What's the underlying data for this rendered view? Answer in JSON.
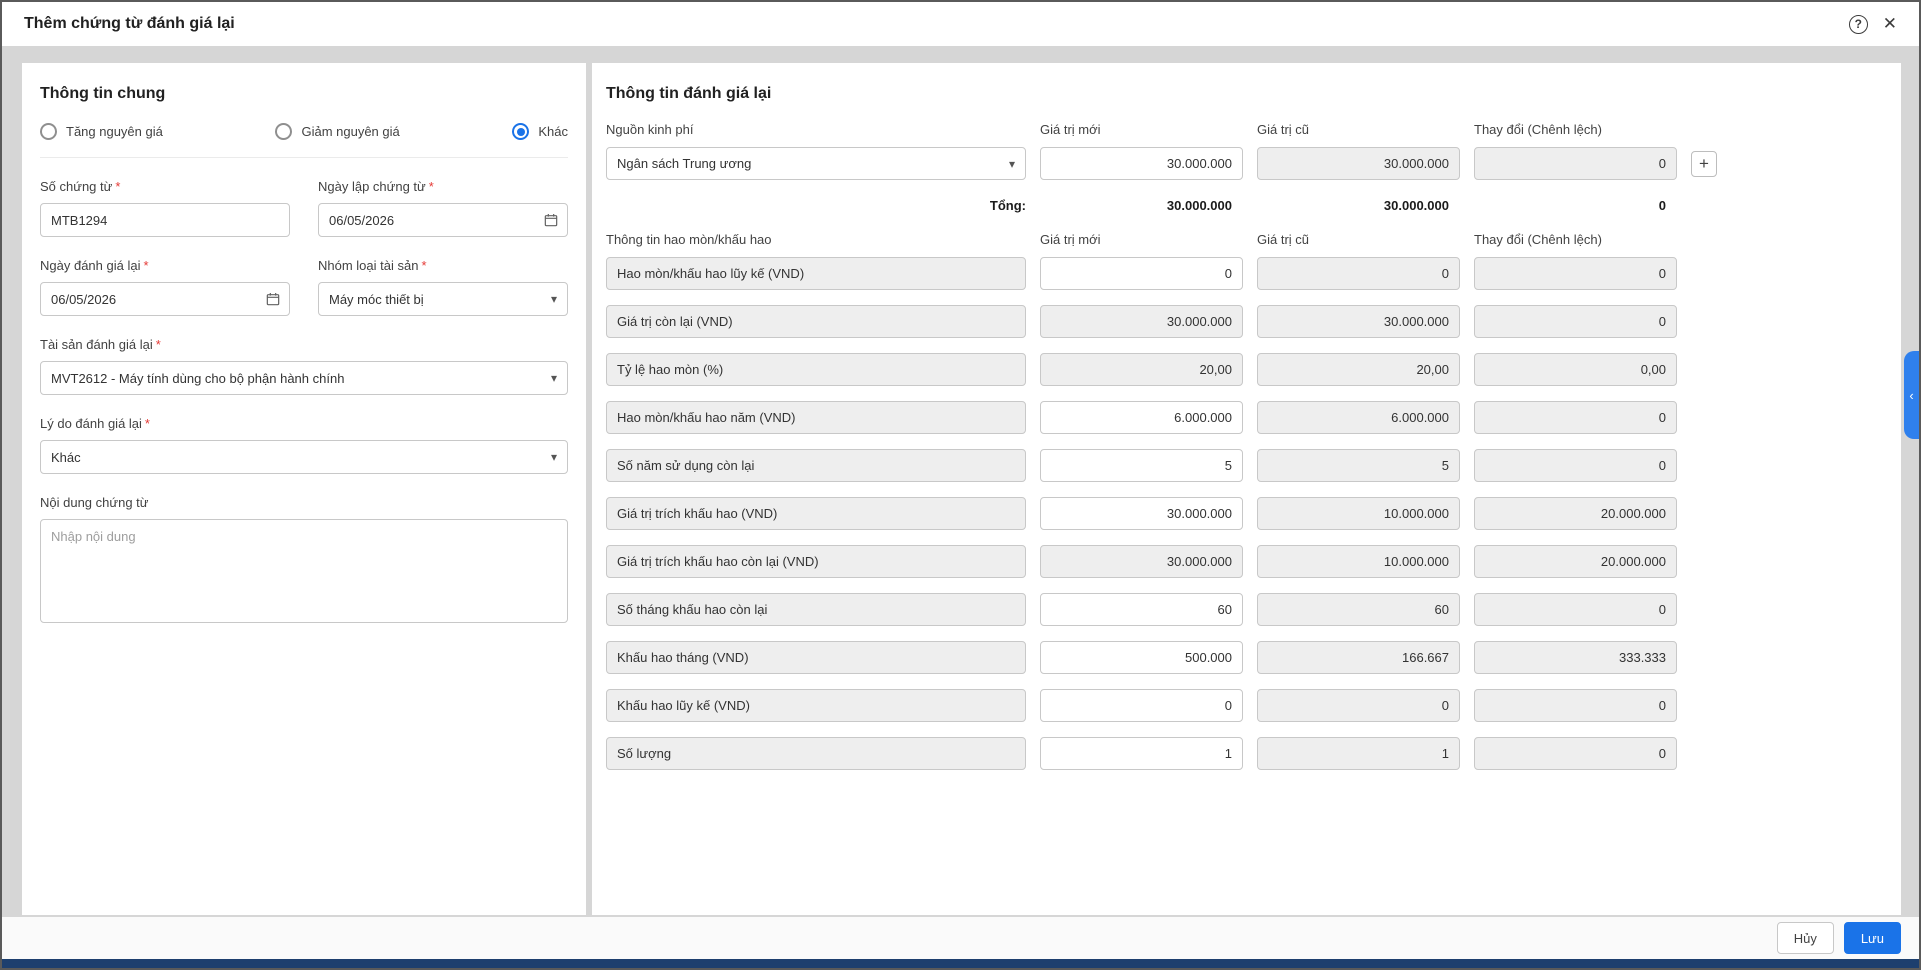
{
  "ui": {
    "required_mark": "*"
  },
  "icons": {
    "help": "?",
    "close": "✕",
    "caret": "▾",
    "add": "+",
    "collapse": "‹"
  },
  "colors": {
    "accent": "#1a73e8",
    "taskbar": "#1d3f6e",
    "readonly_bg": "#eeeeee",
    "required": "#e53935"
  },
  "dialog": {
    "title": "Thêm chứng từ đánh giá lại"
  },
  "general": {
    "heading": "Thông tin chung",
    "radios": [
      {
        "label": "Tăng nguyên giá",
        "checked": false
      },
      {
        "label": "Giảm nguyên giá",
        "checked": false
      },
      {
        "label": "Khác",
        "checked": true
      }
    ],
    "document_number": {
      "label": "Số chứng từ",
      "value": "MTB1294"
    },
    "issue_date": {
      "label": "Ngày lập chứng từ",
      "value": "06/05/2026"
    },
    "revaluation_date": {
      "label": "Ngày đánh giá lại",
      "value": "06/05/2026"
    },
    "asset_group": {
      "label": "Nhóm loại tài sản",
      "value": "Máy móc thiết bị"
    },
    "asset": {
      "label": "Tài sản đánh giá lại",
      "value": "MVT2612 - Máy tính dùng cho bộ phận hành chính"
    },
    "reason": {
      "label": "Lý do đánh giá lại",
      "value": "Khác"
    },
    "content": {
      "label": "Nội dung chứng từ",
      "placeholder": "Nhập nội dung"
    }
  },
  "revaluation": {
    "heading": "Thông tin đánh giá lại",
    "columns": {
      "source": "Nguồn kinh phí",
      "new": "Giá trị mới",
      "old": "Giá trị cũ",
      "change": "Thay đổi (Chênh lệch)"
    },
    "funding": {
      "source": "Ngân sách Trung ương",
      "new": "30.000.000",
      "old": "30.000.000",
      "change": "0"
    },
    "total": {
      "label": "Tổng:",
      "new": "30.000.000",
      "old": "30.000.000",
      "change": "0"
    },
    "depreciation": {
      "heading": "Thông tin hao mòn/khấu hao",
      "rows": [
        {
          "label": "Hao mòn/khấu hao lũy kế (VND)",
          "new": "0",
          "old": "0",
          "change": "0",
          "editable": true
        },
        {
          "label": "Giá trị còn lại (VND)",
          "new": "30.000.000",
          "old": "30.000.000",
          "change": "0",
          "editable": false
        },
        {
          "label": "Tỷ lệ hao mòn (%)",
          "new": "20,00",
          "old": "20,00",
          "change": "0,00",
          "editable": false
        },
        {
          "label": "Hao mòn/khấu hao năm (VND)",
          "new": "6.000.000",
          "old": "6.000.000",
          "change": "0",
          "editable": true
        },
        {
          "label": "Số năm sử dụng còn lại",
          "new": "5",
          "old": "5",
          "change": "0",
          "editable": true
        },
        {
          "label": "Giá trị trích khấu hao (VND)",
          "new": "30.000.000",
          "old": "10.000.000",
          "change": "20.000.000",
          "editable": true
        },
        {
          "label": "Giá trị trích khấu hao còn lại (VND)",
          "new": "30.000.000",
          "old": "10.000.000",
          "change": "20.000.000",
          "editable": false
        },
        {
          "label": "Số tháng khấu hao còn lại",
          "new": "60",
          "old": "60",
          "change": "0",
          "editable": true
        },
        {
          "label": "Khấu hao tháng (VND)",
          "new": "500.000",
          "old": "166.667",
          "change": "333.333",
          "editable": true
        },
        {
          "label": "Khấu hao lũy kế (VND)",
          "new": "0",
          "old": "0",
          "change": "0",
          "editable": true
        },
        {
          "label": "Số lượng",
          "new": "1",
          "old": "1",
          "change": "0",
          "editable": true
        }
      ]
    }
  },
  "footer": {
    "cancel": "Hủy",
    "save": "Lưu"
  }
}
